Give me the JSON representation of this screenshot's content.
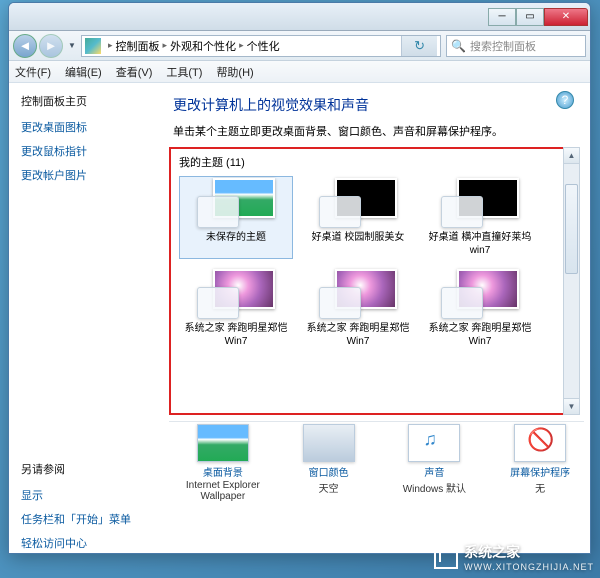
{
  "breadcrumb": {
    "seg1": "控制面板",
    "seg2": "外观和个性化",
    "seg3": "个性化"
  },
  "search": {
    "placeholder": "搜索控制面板"
  },
  "menu": {
    "file": "文件(F)",
    "edit": "编辑(E)",
    "view": "查看(V)",
    "tools": "工具(T)",
    "help": "帮助(H)"
  },
  "sidebar": {
    "home": "控制面板主页",
    "links": [
      "更改桌面图标",
      "更改鼠标指针",
      "更改帐户图片"
    ],
    "see_also_hdr": "另请参阅",
    "see_also": [
      "显示",
      "任务栏和「开始」菜单",
      "轻松访问中心"
    ]
  },
  "main": {
    "title": "更改计算机上的视觉效果和声音",
    "desc": "单击某个主题立即更改桌面背景、窗口颜色、声音和屏幕保护程序。",
    "category": "我的主题 (11)",
    "themes": [
      {
        "name": "未保存的主题",
        "kind": "sky",
        "sel": true
      },
      {
        "name": "好桌道 校园制服美女",
        "kind": "blk"
      },
      {
        "name": "好桌道 横冲直撞好莱坞win7",
        "kind": "blk"
      },
      {
        "name": "系统之家 奔跑明星郑恺Win7",
        "kind": "girl"
      },
      {
        "name": "系统之家 奔跑明星郑恺Win7",
        "kind": "girl"
      },
      {
        "name": "系统之家 奔跑明星郑恺Win7",
        "kind": "girl"
      }
    ],
    "bottom": {
      "bg": {
        "label": "桌面背景",
        "value": "Internet Explorer Wallpaper"
      },
      "color": {
        "label": "窗口颜色",
        "value": "天空"
      },
      "sound": {
        "label": "声音",
        "value": "Windows 默认"
      },
      "saver": {
        "label": "屏幕保护程序",
        "value": "无"
      }
    }
  },
  "watermark": {
    "name": "系统之家",
    "url": "WWW.XITONGZHIJIA.NET"
  }
}
